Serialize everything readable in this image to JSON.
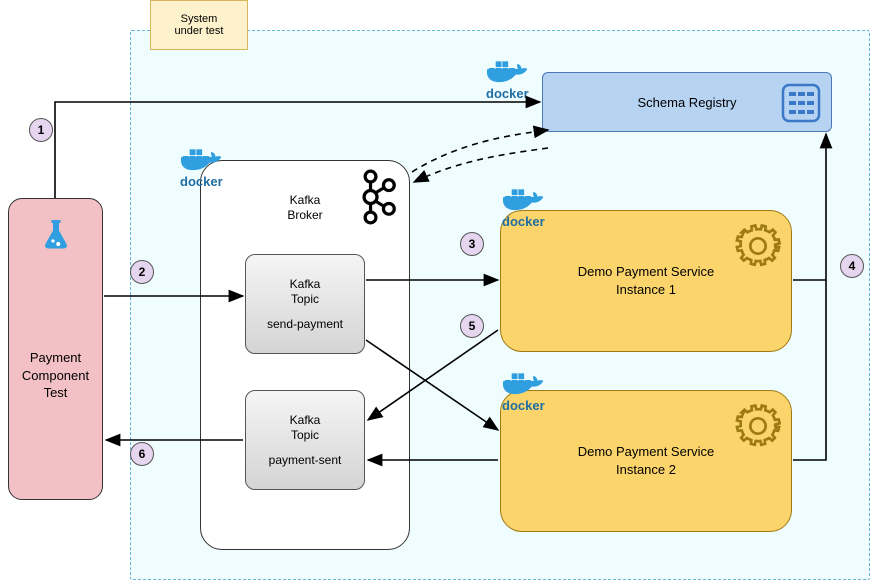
{
  "system_under_test_label": "System\nunder test",
  "payment_component_test": {
    "label": "Payment\nComponent\nTest"
  },
  "kafka_broker": {
    "label": "Kafka\nBroker",
    "topics": [
      {
        "label": "Kafka\nTopic",
        "name": "send-payment"
      },
      {
        "label": "Kafka\nTopic",
        "name": "payment-sent"
      }
    ]
  },
  "schema_registry": {
    "label": "Schema Registry"
  },
  "services": [
    {
      "label": "Demo Payment Service\nInstance 1"
    },
    {
      "label": "Demo Payment Service\nInstance 2"
    }
  ],
  "docker_label": "docker",
  "steps": [
    "1",
    "2",
    "3",
    "4",
    "5",
    "6"
  ],
  "colors": {
    "sut_bg": "#f0fdff",
    "sut_border": "#68b3d6",
    "note_bg": "#fdf2cc",
    "note_border": "#d6b656",
    "pct_bg": "#f3c1c5",
    "registry_bg": "#b7d3f2",
    "registry_border": "#4a78b5",
    "svc_bg": "#fbd56b",
    "svc_border": "#9e7a15",
    "step_bg": "#e6d5ef",
    "docker_blue": "#2f9fe0",
    "docker_text": "#1f6ea3"
  }
}
